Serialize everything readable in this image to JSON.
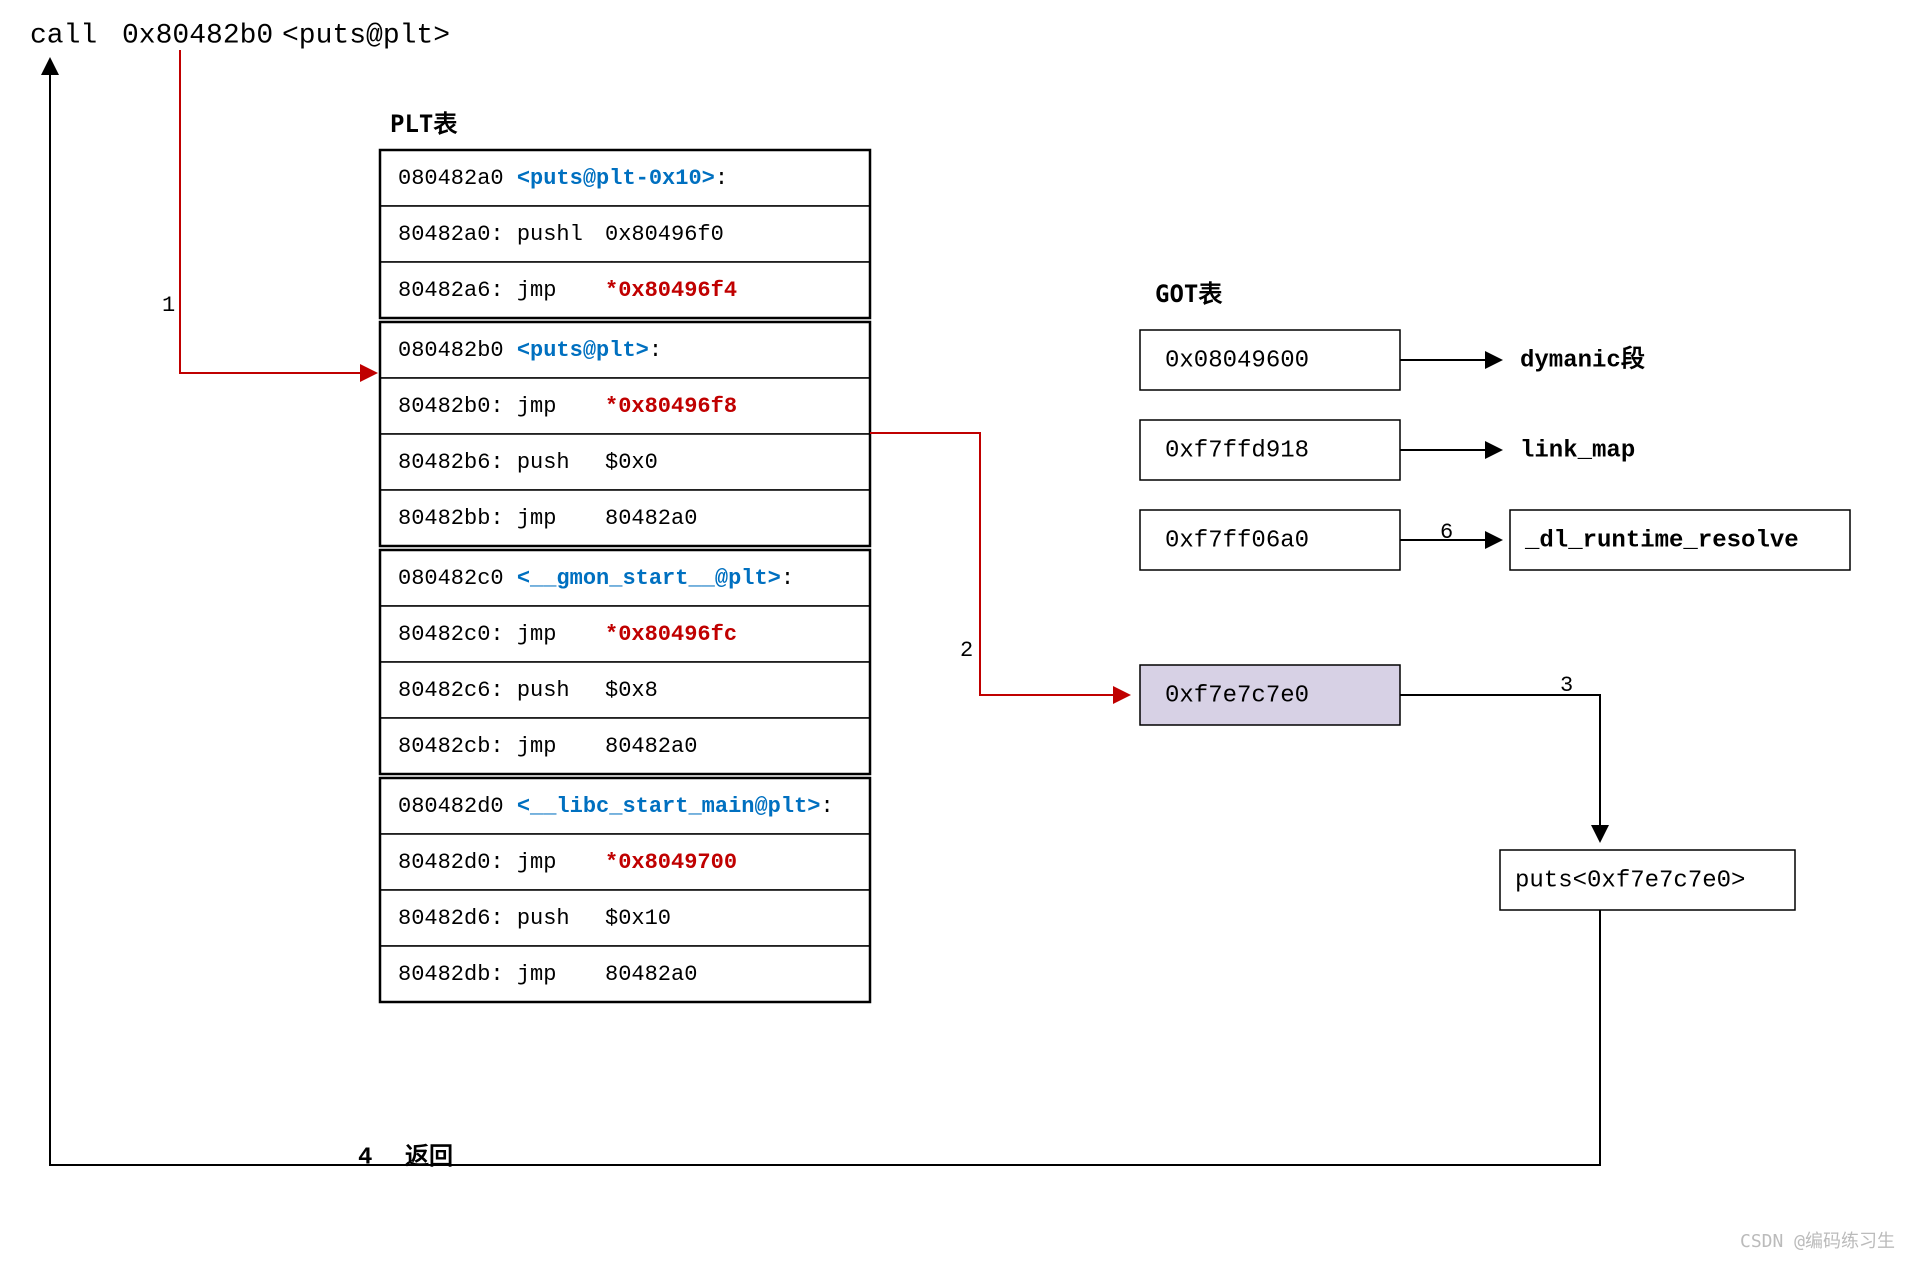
{
  "call_line": {
    "op": "call",
    "addr": "0x80482b0",
    "sym": "<puts@plt>"
  },
  "plt": {
    "title": "PLT表",
    "rows": [
      {
        "addr": "080482a0",
        "sym": "<puts@plt-0x10>",
        "sym_color": "#0070c0",
        "rest": ":"
      },
      {
        "addr": "80482a0:",
        "op": "pushl",
        "arg": "0x80496f0",
        "arg_color": "#000"
      },
      {
        "addr": "80482a6:",
        "op": "jmp",
        "arg": "*0x80496f4",
        "arg_color": "#c00000"
      },
      {
        "addr": "080482b0",
        "sym": "<puts@plt>",
        "sym_color": "#0070c0",
        "rest": ":"
      },
      {
        "addr": "80482b0:",
        "op": "jmp",
        "arg": "*0x80496f8",
        "arg_color": "#c00000"
      },
      {
        "addr": "80482b6:",
        "op": "push",
        "arg": "$0x0",
        "arg_color": "#000"
      },
      {
        "addr": "80482bb:",
        "op": "jmp",
        "arg": "80482a0",
        "arg_color": "#000"
      },
      {
        "addr": "080482c0",
        "sym": "<__gmon_start__@plt>",
        "sym_color": "#0070c0",
        "rest": ":"
      },
      {
        "addr": "80482c0:",
        "op": "jmp",
        "arg": "*0x80496fc",
        "arg_color": "#c00000"
      },
      {
        "addr": "80482c6:",
        "op": "push",
        "arg": "$0x8",
        "arg_color": "#000"
      },
      {
        "addr": "80482cb:",
        "op": "jmp",
        "arg": "80482a0",
        "arg_color": "#000"
      },
      {
        "addr": "080482d0",
        "sym": "<__libc_start_main@plt>",
        "sym_color": "#0070c0",
        "rest": ":"
      },
      {
        "addr": "80482d0:",
        "op": "jmp",
        "arg": "*0x8049700",
        "arg_color": "#c00000"
      },
      {
        "addr": "80482d6:",
        "op": "push",
        "arg": "$0x10",
        "arg_color": "#000"
      },
      {
        "addr": "80482db:",
        "op": "jmp",
        "arg": "80482a0",
        "arg_color": "#000"
      }
    ]
  },
  "got": {
    "title": "GOT表",
    "rows": [
      {
        "value": "0x08049600",
        "target": "dymanic段"
      },
      {
        "value": "0xf7ffd918",
        "target": "link_map"
      },
      {
        "value": "0xf7ff06a0",
        "target": "_dl_runtime_resolve"
      },
      {
        "value": "0xf7e7c7e0"
      }
    ]
  },
  "puts_resolved": "puts<0xf7e7c7e0>",
  "labels": {
    "s1": "1",
    "s2": "2",
    "s3": "3",
    "s4": "4",
    "s6": "6",
    "ret": "返回"
  },
  "watermark": "CSDN @编码练习生"
}
